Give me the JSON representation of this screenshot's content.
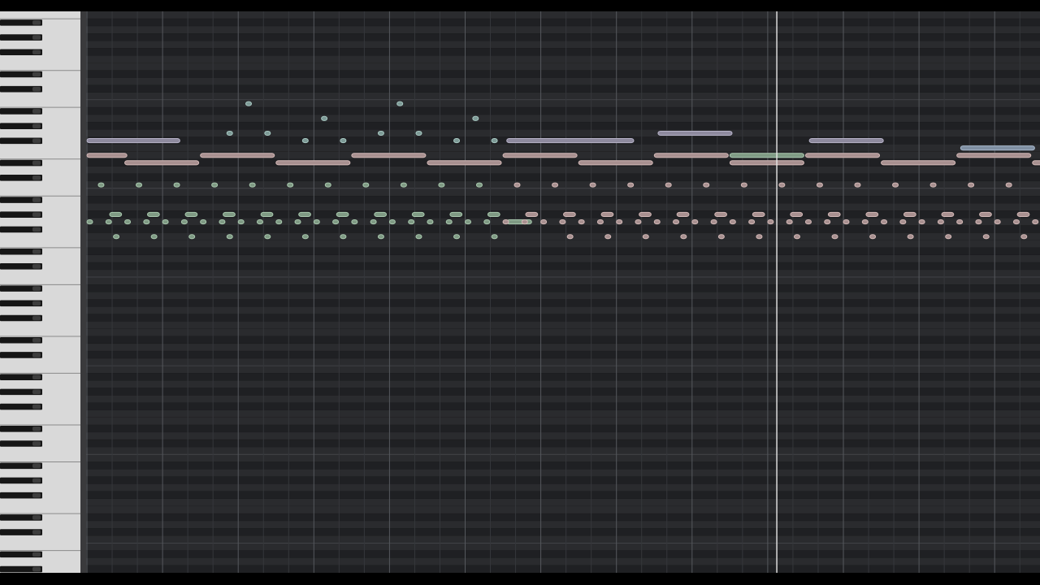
{
  "colors": {
    "background": "#000000",
    "row_light": "#2a2b2e",
    "row_dark": "#1f2023",
    "grid_beat": "#35373b",
    "grid_bar": "#55585d",
    "octave_line": "#5a5d62",
    "playhead": "#e8e8e8",
    "white_key": "#d9d9d9",
    "black_key": "#161616"
  },
  "tracks": [
    {
      "name": "track-lavender",
      "color": "#8e8a9e",
      "stroke": "#b7b3c8"
    },
    {
      "name": "track-rose",
      "color": "#a89090",
      "stroke": "#d2b8b6"
    },
    {
      "name": "track-teal",
      "color": "#7d9a96",
      "stroke": "#a9c9c3"
    },
    {
      "name": "track-green",
      "color": "#7f9a84",
      "stroke": "#a9c8ae"
    },
    {
      "name": "track-blue",
      "color": "#8090a3",
      "stroke": "#a8b8cc"
    }
  ],
  "notes": {
    "lavender": [
      {
        "pitch": 66,
        "start": 0.0,
        "len": 1.25
      },
      {
        "pitch": 66,
        "start": 5.55,
        "len": 1.7
      },
      {
        "pitch": 67,
        "start": 7.55,
        "len": 1.0
      },
      {
        "pitch": 66,
        "start": 9.55,
        "len": 1.0
      }
    ],
    "blue": [
      {
        "pitch": 65,
        "start": 11.55,
        "len": 1.0
      }
    ],
    "rose_pad_high": [
      {
        "pitch": 64,
        "start": 0.0,
        "len": 0.55
      },
      {
        "pitch": 64,
        "start": 1.5,
        "len": 1.0
      },
      {
        "pitch": 64,
        "start": 3.5,
        "len": 1.0
      },
      {
        "pitch": 64,
        "start": 5.5,
        "len": 1.0
      },
      {
        "pitch": 64,
        "start": 7.5,
        "len": 1.0
      },
      {
        "pitch": 64,
        "start": 9.5,
        "len": 1.0
      },
      {
        "pitch": 64,
        "start": 11.5,
        "len": 1.0
      }
    ],
    "rose_pad_low": [
      {
        "pitch": 63,
        "start": 0.5,
        "len": 1.0
      },
      {
        "pitch": 63,
        "start": 2.5,
        "len": 1.0
      },
      {
        "pitch": 63,
        "start": 4.5,
        "len": 1.0
      },
      {
        "pitch": 63,
        "start": 6.5,
        "len": 1.0
      },
      {
        "pitch": 63,
        "start": 8.5,
        "len": 1.0
      },
      {
        "pitch": 63,
        "start": 10.5,
        "len": 1.0
      },
      {
        "pitch": 63,
        "start": 12.5,
        "len": 0.2
      }
    ],
    "green_pad": [
      {
        "pitch": 64,
        "start": 8.5,
        "len": 1.0
      },
      {
        "pitch": 55,
        "start": 5.55,
        "len": 0.35
      }
    ],
    "teal_arp": [
      {
        "pitch": 71,
        "start": 2.1,
        "len": 0.08
      },
      {
        "pitch": 69,
        "start": 3.1,
        "len": 0.08
      },
      {
        "pitch": 67,
        "start": 1.85,
        "len": 0.08
      },
      {
        "pitch": 67,
        "start": 2.35,
        "len": 0.08
      },
      {
        "pitch": 66,
        "start": 2.85,
        "len": 0.08
      },
      {
        "pitch": 66,
        "start": 3.35,
        "len": 0.08
      },
      {
        "pitch": 71,
        "start": 4.1,
        "len": 0.08
      },
      {
        "pitch": 69,
        "start": 5.1,
        "len": 0.08
      },
      {
        "pitch": 67,
        "start": 3.85,
        "len": 0.08
      },
      {
        "pitch": 67,
        "start": 4.35,
        "len": 0.08
      },
      {
        "pitch": 66,
        "start": 4.85,
        "len": 0.08
      },
      {
        "pitch": 66,
        "start": 5.35,
        "len": 0.08
      }
    ],
    "tail_note": {
      "pitch": 62,
      "start": 12.65,
      "len": 0.08
    }
  },
  "patterns": {
    "bass_step": 0.5,
    "bass_pitch": 60,
    "low_step": 0.5,
    "low_pitch": 53,
    "mid_dash_pitch": 56,
    "mid_dot_pitch": 55,
    "switch_beat": 5.5
  },
  "view": {
    "top_pitch": 83,
    "bottom_pitch": 7,
    "bar_beats": 1,
    "subdivisions": 3,
    "playhead_beat": 9.12
  }
}
